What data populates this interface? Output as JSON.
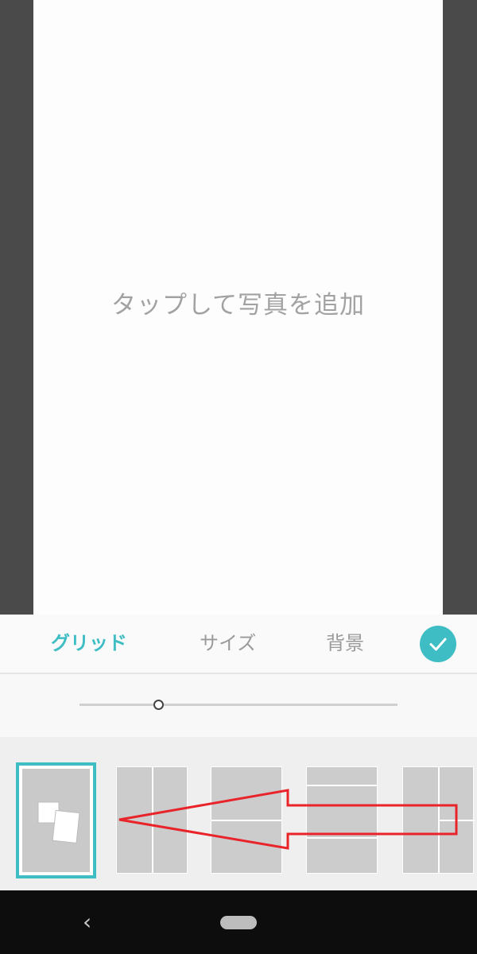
{
  "canvas": {
    "hint_text": "タップして写真を追加"
  },
  "tabs": {
    "grid": "グリッド",
    "size": "サイズ",
    "background": "背景"
  },
  "confirm": {
    "icon": "check-icon"
  },
  "slider": {
    "value_fraction": 0.25
  },
  "layouts": [
    {
      "type": "freeform",
      "selected": true
    },
    {
      "type": "two-columns",
      "selected": false
    },
    {
      "type": "two-rows",
      "selected": false
    },
    {
      "type": "three-rows",
      "selected": false
    },
    {
      "type": "column-plus-stack",
      "selected": false
    }
  ],
  "annotation": {
    "type": "arrow",
    "direction": "left",
    "color": "#e8242a"
  },
  "colors": {
    "accent": "#3fbdc4",
    "background_dark": "#4a4a4a"
  },
  "navbar": {
    "back_icon": "back-chevron-icon",
    "home_icon": "home-pill-icon"
  }
}
